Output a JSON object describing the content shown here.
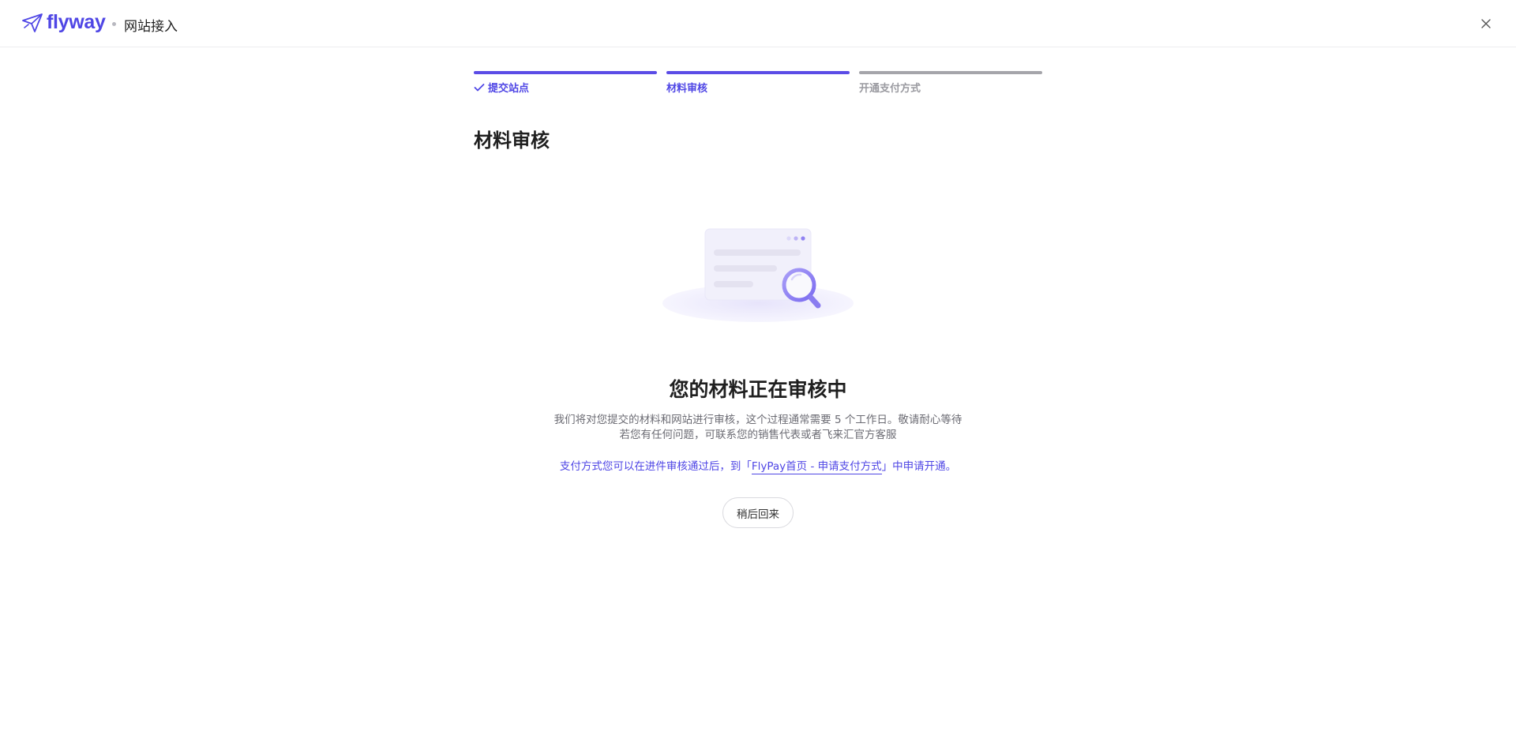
{
  "header": {
    "brand": "flyway",
    "title": "网站接入"
  },
  "steps": [
    {
      "label": "提交站点",
      "state": "done"
    },
    {
      "label": "材料审核",
      "state": "active"
    },
    {
      "label": "开通支付方式",
      "state": "pending"
    }
  ],
  "page_title": "材料审核",
  "status": {
    "title": "您的材料正在审核中",
    "desc_line1": "我们将对您提交的材料和网站进行审核，这个过程通常需要 5 个工作日。敬请耐心等待",
    "desc_line2": "若您有任何问题，可联系您的销售代表或者飞来汇官方客服"
  },
  "notice": {
    "prefix": "支付方式您可以在进件审核通过后，到「",
    "link": "FlyPay首页 - 申请支付方式",
    "suffix": "」中申请开通。"
  },
  "actions": {
    "later_label": "稍后回来"
  },
  "colors": {
    "accent": "#4f46e5",
    "inactive": "#a5a5aa"
  }
}
